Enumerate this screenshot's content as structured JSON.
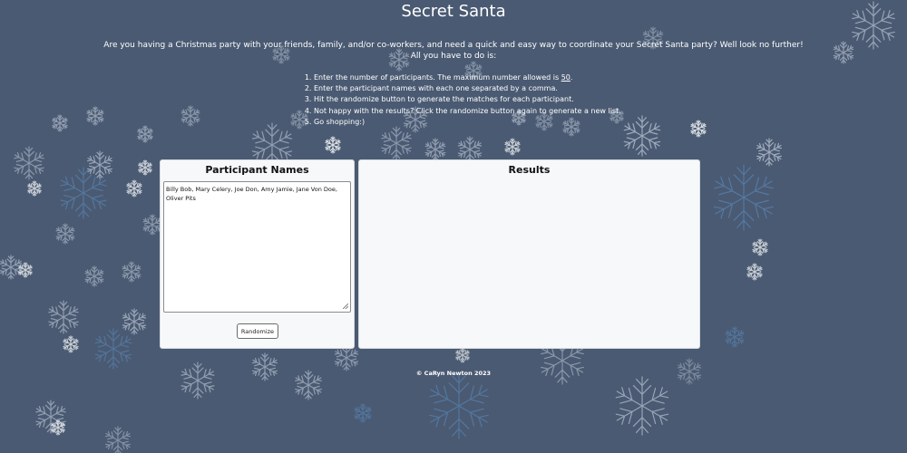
{
  "header": {
    "title": "Secret Santa"
  },
  "intro": {
    "line1": "Are you having a Christmas party with your friends, family, and/or co-workers, and need a quick and easy way to coordinate your Secret Santa party? Well look no further!",
    "line2": "All you have to do is:"
  },
  "steps": {
    "step1_before": "Enter the number of participants. The maximum number allowed is ",
    "step1_max": "50",
    "step1_after": ".",
    "step2": "Enter the participant names with each one separated by a comma.",
    "step3": "Hit the randomize button to generate the matches for each participant.",
    "step4": "Not happy with the results? Click the randomize button again to generate a new list.",
    "step5": "Go shopping:)"
  },
  "participants_panel": {
    "title": "Participant Names",
    "names_value": "Billy Bob, Mary Celery, Joe Don, Amy Jamie, Jane Von Doe, Oliver Pits",
    "randomize_label": "Randomize"
  },
  "results_panel": {
    "title": "Results"
  },
  "footer": {
    "text": "© CaRyn Newton 2023"
  },
  "colors": {
    "background": "#4a5a72",
    "panel": "#f7f8fa",
    "snowflake_light": "#d9e2ee",
    "snowflake_blue": "#5b8fc4"
  },
  "icons": {
    "decoration": "snowflake-icon"
  }
}
